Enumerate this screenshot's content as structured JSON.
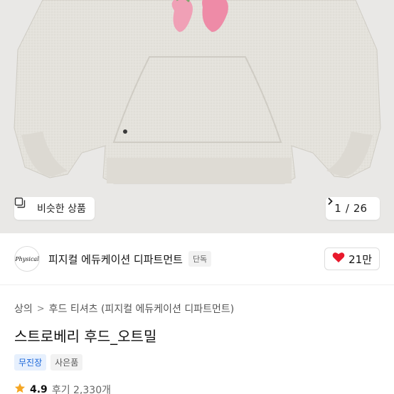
{
  "gallery": {
    "similar_label": "비슷한 상품",
    "current_page": "1",
    "total_pages": "26",
    "page_separator": "/",
    "next_icon": "chevron-right-icon",
    "similar_icon": "similar-items-icon"
  },
  "brand": {
    "logo_text": "Physical",
    "name": "피지컬 에듀케이션 디파트먼트",
    "exclusive_label": "단독",
    "like_count": "21만",
    "like_icon": "heart-icon",
    "like_color": "#e8192c"
  },
  "breadcrumb": {
    "items": [
      "상의",
      "후드 티셔츠 (피지컬 에듀케이션 디파트먼트)"
    ],
    "separator": ">"
  },
  "product": {
    "title": "스트로베리 후드_오트밀",
    "badges": [
      "무진장",
      "사은품"
    ],
    "rating_icon": "star-icon",
    "rating": "4.9",
    "review_text": "후기 2,330개"
  },
  "colors": {
    "accent_blue": "#1a66d9",
    "star": "#f5a623"
  }
}
